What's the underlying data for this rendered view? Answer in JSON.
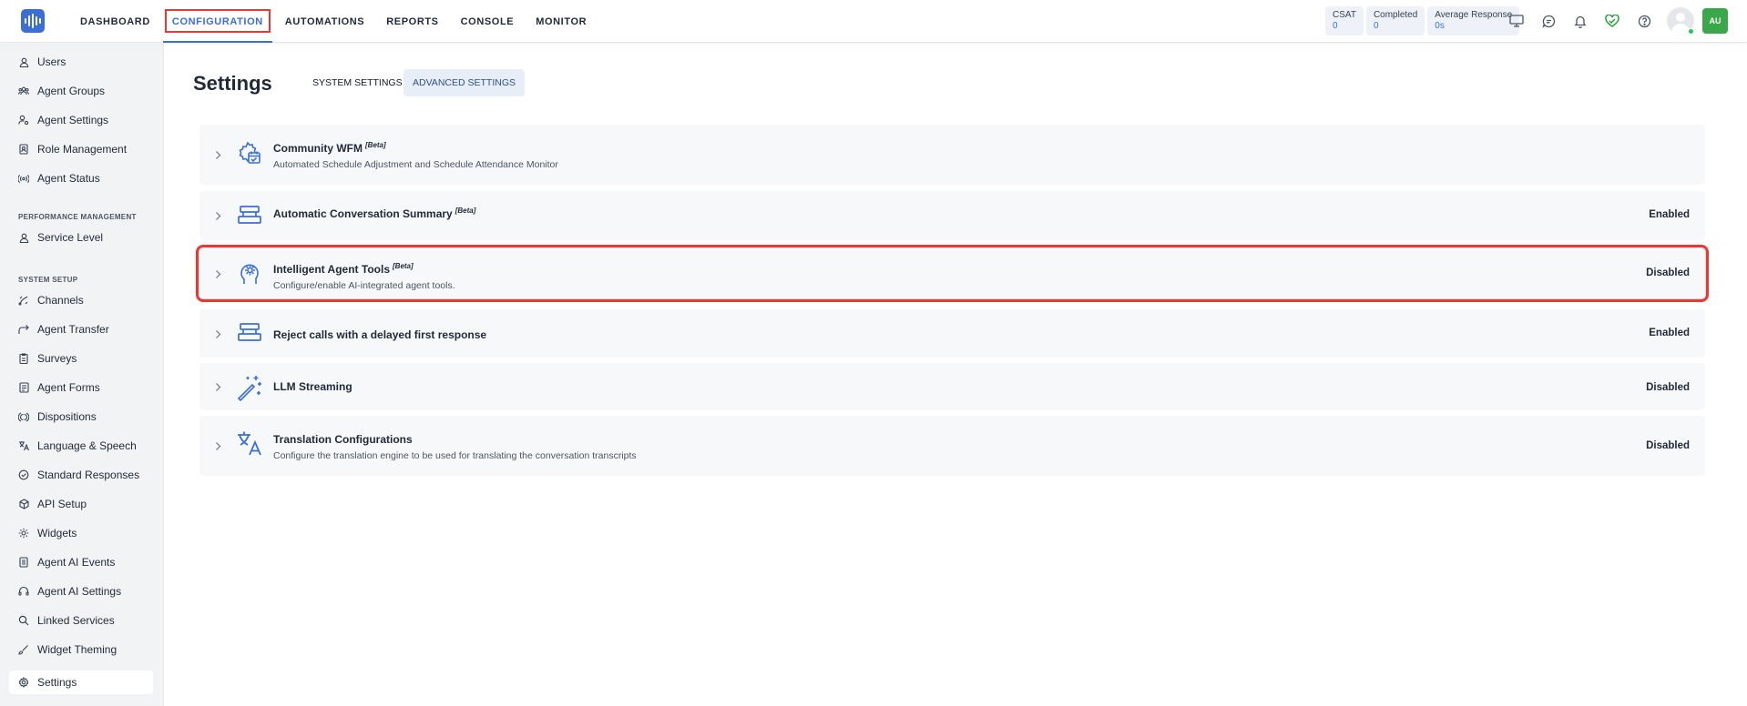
{
  "nav": {
    "items": [
      {
        "label": "DASHBOARD"
      },
      {
        "label": "CONFIGURATION"
      },
      {
        "label": "AUTOMATIONS"
      },
      {
        "label": "REPORTS"
      },
      {
        "label": "CONSOLE"
      },
      {
        "label": "MONITOR"
      }
    ],
    "active_index": 1
  },
  "stats": [
    {
      "label": "CSAT",
      "value": "0"
    },
    {
      "label": "Completed",
      "value": "0"
    },
    {
      "label": "Average Response",
      "value": "0s"
    }
  ],
  "header_icons": [
    "monitor-icon",
    "chat-icon",
    "bell-icon",
    "heart-check-icon",
    "help-icon"
  ],
  "user": {
    "initials": "AU",
    "status_color": "#22c55e",
    "badge_color": "#3aa84a"
  },
  "sidebar": {
    "group1": [
      {
        "label": "Users",
        "icon": "user-icon"
      },
      {
        "label": "Agent Groups",
        "icon": "group-icon"
      },
      {
        "label": "Agent Settings",
        "icon": "user-settings-icon"
      },
      {
        "label": "Role Management",
        "icon": "role-icon"
      },
      {
        "label": "Agent Status",
        "icon": "broadcast-icon"
      }
    ],
    "section_performance": "PERFORMANCE MANAGEMENT",
    "group2": [
      {
        "label": "Service Level",
        "icon": "user-icon"
      }
    ],
    "section_system": "SYSTEM SETUP",
    "group3": [
      {
        "label": "Channels",
        "icon": "channels-icon"
      },
      {
        "label": "Agent Transfer",
        "icon": "transfer-icon"
      },
      {
        "label": "Surveys",
        "icon": "clipboard-icon"
      },
      {
        "label": "Agent Forms",
        "icon": "form-icon"
      },
      {
        "label": "Dispositions",
        "icon": "dispositions-icon"
      },
      {
        "label": "Language & Speech",
        "icon": "translate-icon"
      },
      {
        "label": "Standard Responses",
        "icon": "check-circle-icon"
      },
      {
        "label": "API Setup",
        "icon": "api-icon"
      },
      {
        "label": "Widgets",
        "icon": "widget-icon"
      },
      {
        "label": "Agent AI Events",
        "icon": "events-icon"
      },
      {
        "label": "Agent AI Settings",
        "icon": "headset-icon"
      },
      {
        "label": "Linked Services",
        "icon": "search-icon"
      },
      {
        "label": "Widget Theming",
        "icon": "brush-icon"
      },
      {
        "label": "Settings",
        "icon": "gear-icon"
      }
    ],
    "active": "Settings"
  },
  "page": {
    "title": "Settings",
    "tabs": [
      {
        "label": "SYSTEM SETTINGS"
      },
      {
        "label": "ADVANCED SETTINGS"
      }
    ],
    "active_tab": 1
  },
  "settings": [
    {
      "title": "Community WFM",
      "beta": "[Beta]",
      "description": "Automated Schedule Adjustment and Schedule Attendance Monitor",
      "status": "",
      "icon": "calendar-gear-icon"
    },
    {
      "title": "Automatic Conversation Summary",
      "beta": "[Beta]",
      "description": "",
      "status": "Enabled",
      "icon": "stack-icon"
    },
    {
      "title": "Intelligent Agent Tools",
      "beta": "[Beta]",
      "description": "Configure/enable AI-integrated agent tools.",
      "status": "Disabled",
      "icon": "brain-gear-icon"
    },
    {
      "title": "Reject calls with a delayed first response",
      "beta": "",
      "description": "",
      "status": "Enabled",
      "icon": "stack-icon"
    },
    {
      "title": "LLM Streaming",
      "beta": "",
      "description": "",
      "status": "Disabled",
      "icon": "magic-wand-icon"
    },
    {
      "title": "Translation Configurations",
      "beta": "",
      "description": "Configure the translation engine to be used for translating the conversation transcripts",
      "status": "Disabled",
      "icon": "translate-icon"
    }
  ],
  "colors": {
    "accent": "#3b6fd4",
    "highlight": "#e53935"
  }
}
